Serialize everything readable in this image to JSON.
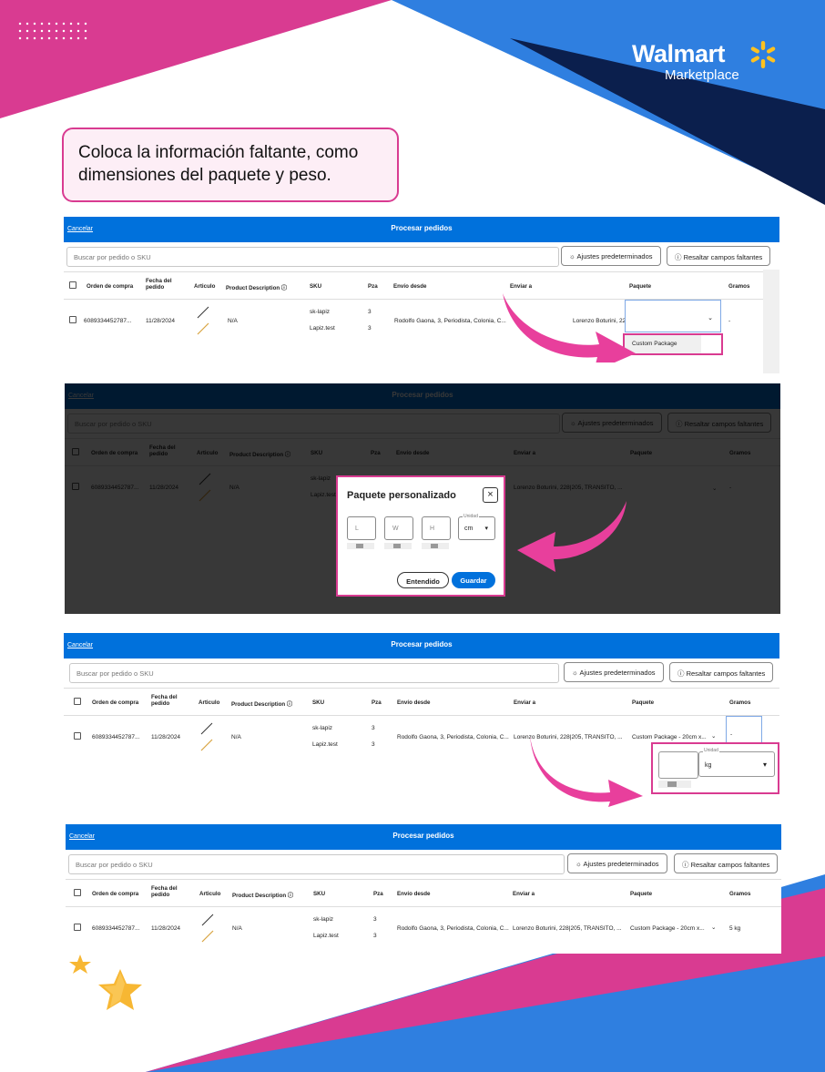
{
  "colors": {
    "brand_blue": "#0071dc",
    "pink": "#d93b91",
    "navy": "#0b1f4d",
    "walmart_yellow": "#ffc220",
    "light_blue": "#2f7fe0"
  },
  "logo": {
    "word": "Walmart",
    "sub": "Marketplace",
    "icon": "spark-icon"
  },
  "callout": {
    "line1": "Coloca la información faltante, como",
    "line2": "dimensiones del paquete y peso."
  },
  "common": {
    "cancel": "Cancelar",
    "title": "Procesar pedidos",
    "search_placeholder": "Buscar por pedido o SKU",
    "btn_defaults": "Ajustes predeterminados",
    "btn_highlight": "Resaltar campos faltantes",
    "headers": {
      "order": "Orden de compra",
      "date": "Fecha del pedido",
      "item": "Articulo",
      "desc": "Product Description",
      "sku": "SKU",
      "pza": "Pza",
      "from": "Envío desde",
      "to": "Enviar a",
      "package": "Paquete",
      "grams": "Gramos"
    },
    "row": {
      "order": "6089334452787...",
      "date": "11/28/2024",
      "desc": "N/A",
      "sku1": "sk-lapiz",
      "sku2": "Lapiz.test",
      "pza1": "3",
      "pza2": "3",
      "from": "Rodolfo Gaona, 3, Periodista, Colonia, C...",
      "to": "Lorenzo Boturini, 228|205, TRANSITO, ..."
    }
  },
  "panel1": {
    "grams": "-",
    "dropdown_option": "Custom Package"
  },
  "panel2": {
    "modal_title": "Paquete personalizado",
    "close": "×",
    "dims": [
      "L",
      "W",
      "H"
    ],
    "unit_label": "Unidad",
    "unit_value": "cm",
    "btn_ok": "Entendido",
    "btn_save": "Guardar"
  },
  "panel3": {
    "package": "Custom Package - 20cm x...",
    "grams": "-",
    "unit_label": "Unidad",
    "unit_value": "kg"
  },
  "panel4": {
    "package": "Custom Package - 20cm x...",
    "grams": "5 kg"
  }
}
